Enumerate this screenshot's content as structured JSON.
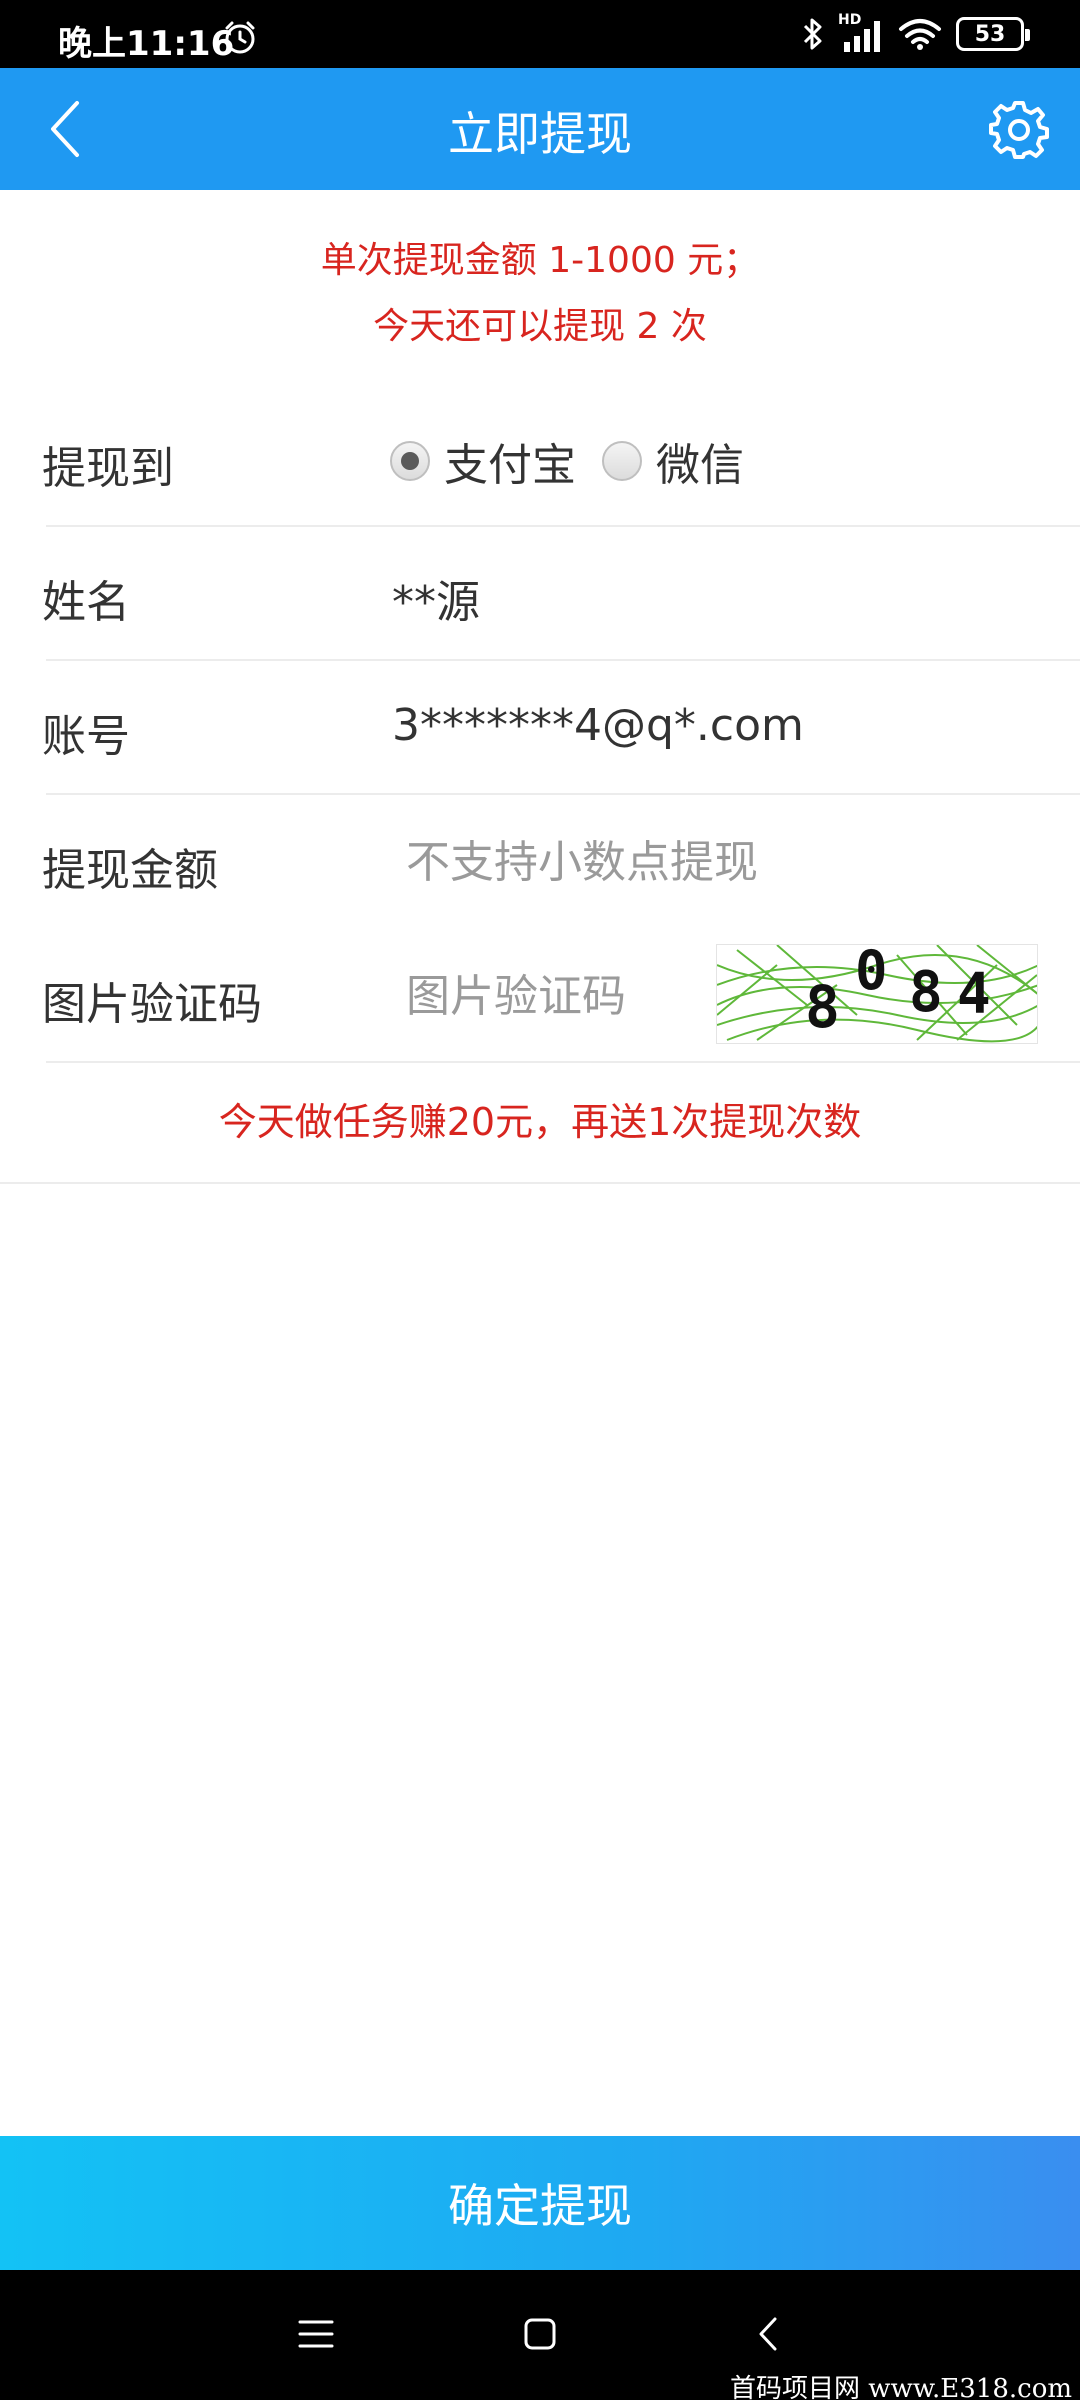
{
  "status_bar": {
    "time": "晚上11:16",
    "network_label": "HD",
    "battery": "53"
  },
  "nav": {
    "title": "立即提现"
  },
  "notice": {
    "line1": "单次提现金额 1-1000 元；",
    "line2": "今天还可以提现 2 次"
  },
  "form": {
    "method_label": "提现到",
    "options": [
      {
        "label": "支付宝",
        "selected": true
      },
      {
        "label": "微信",
        "selected": false
      }
    ],
    "name_label": "姓名",
    "name_value": "**源",
    "account_label": "账号",
    "account_value": "3*******4@q*.com",
    "amount_label": "提现金额",
    "amount_placeholder": "不支持小数点提现",
    "captcha_label": "图片验证码",
    "captcha_placeholder": "图片验证码",
    "captcha_code": "8084"
  },
  "promo": "今天做任务赚20元，再送1次提现次数",
  "confirm_button": "确定提现",
  "watermark": "首码项目网 www.E318.com",
  "colors": {
    "primary": "#1f99f2",
    "alert_red": "#d8251f",
    "captcha_green": "#5fb83a"
  }
}
